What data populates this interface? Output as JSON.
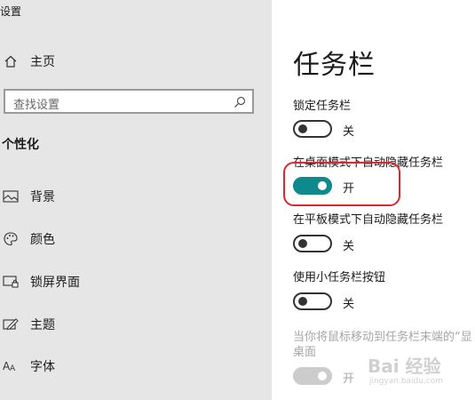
{
  "app": {
    "title": "设置"
  },
  "sidebar": {
    "home_label": "主页",
    "search_placeholder": "查找设置",
    "section_heading": "个性化",
    "items": [
      {
        "label": "背景",
        "icon": "picture-icon"
      },
      {
        "label": "颜色",
        "icon": "palette-icon"
      },
      {
        "label": "锁屏界面",
        "icon": "lock-screen-icon"
      },
      {
        "label": "主题",
        "icon": "theme-icon"
      },
      {
        "label": "字体",
        "icon": "font-icon"
      }
    ]
  },
  "main": {
    "title": "任务栏",
    "settings": [
      {
        "label": "锁定任务栏",
        "state": "关",
        "on": false,
        "enabled": true
      },
      {
        "label": "在桌面模式下自动隐藏任务栏",
        "state": "开",
        "on": true,
        "enabled": true,
        "highlighted": true
      },
      {
        "label": "在平板模式下自动隐藏任务栏",
        "state": "关",
        "on": false,
        "enabled": true
      },
      {
        "label": "使用小任务栏按钮",
        "state": "关",
        "on": false,
        "enabled": true
      },
      {
        "label_line1": "当你将鼠标移动到任务栏末端的“显",
        "label_line2": "桌面",
        "state": "开",
        "on": true,
        "enabled": false
      }
    ]
  },
  "watermark": {
    "text": "Bai 经验",
    "sub": "jingyan.baidu.com"
  },
  "colors": {
    "accent": "#0f8a8c",
    "highlight": "#d9282f",
    "sidebar_bg": "#e6e6e6"
  }
}
